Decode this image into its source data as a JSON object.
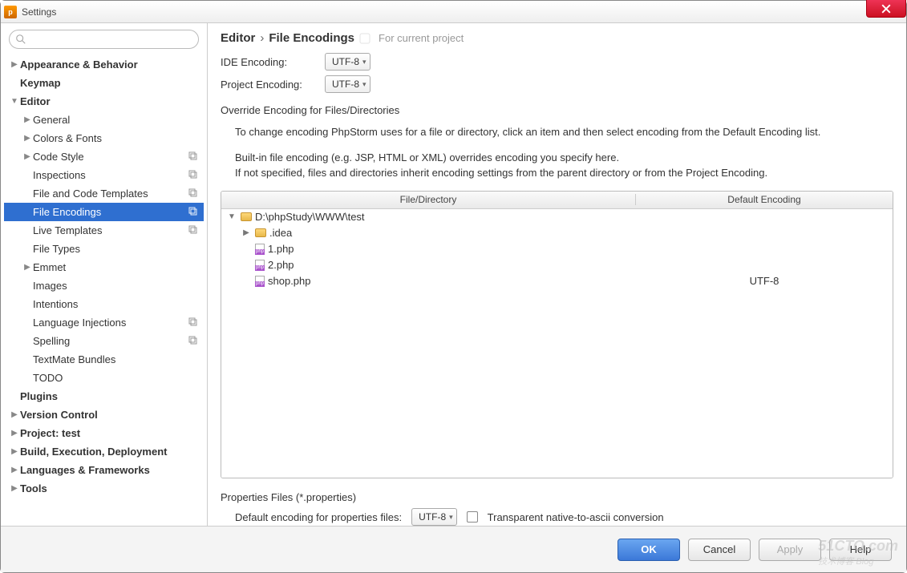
{
  "window": {
    "title": "Settings"
  },
  "sidebar": {
    "items": [
      {
        "label": "Appearance & Behavior",
        "bold": true,
        "arrow": "▶",
        "indent": 0
      },
      {
        "label": "Keymap",
        "bold": true,
        "arrow": "",
        "indent": 0
      },
      {
        "label": "Editor",
        "bold": true,
        "arrow": "▼",
        "indent": 0
      },
      {
        "label": "General",
        "arrow": "▶",
        "indent": 1
      },
      {
        "label": "Colors & Fonts",
        "arrow": "▶",
        "indent": 1
      },
      {
        "label": "Code Style",
        "arrow": "▶",
        "indent": 1,
        "copy": true
      },
      {
        "label": "Inspections",
        "arrow": "",
        "indent": 1,
        "copy": true
      },
      {
        "label": "File and Code Templates",
        "arrow": "",
        "indent": 1,
        "copy": true
      },
      {
        "label": "File Encodings",
        "arrow": "",
        "indent": 1,
        "copy": true,
        "selected": true
      },
      {
        "label": "Live Templates",
        "arrow": "",
        "indent": 1,
        "copy": true
      },
      {
        "label": "File Types",
        "arrow": "",
        "indent": 1
      },
      {
        "label": "Emmet",
        "arrow": "▶",
        "indent": 1
      },
      {
        "label": "Images",
        "arrow": "",
        "indent": 1
      },
      {
        "label": "Intentions",
        "arrow": "",
        "indent": 1
      },
      {
        "label": "Language Injections",
        "arrow": "",
        "indent": 1,
        "copy": true
      },
      {
        "label": "Spelling",
        "arrow": "",
        "indent": 1,
        "copy": true
      },
      {
        "label": "TextMate Bundles",
        "arrow": "",
        "indent": 1
      },
      {
        "label": "TODO",
        "arrow": "",
        "indent": 1
      },
      {
        "label": "Plugins",
        "bold": true,
        "arrow": "",
        "indent": 0
      },
      {
        "label": "Version Control",
        "bold": true,
        "arrow": "▶",
        "indent": 0
      },
      {
        "label": "Project: test",
        "bold": true,
        "arrow": "▶",
        "indent": 0
      },
      {
        "label": "Build, Execution, Deployment",
        "bold": true,
        "arrow": "▶",
        "indent": 0
      },
      {
        "label": "Languages & Frameworks",
        "bold": true,
        "arrow": "▶",
        "indent": 0
      },
      {
        "label": "Tools",
        "bold": true,
        "arrow": "▶",
        "indent": 0
      }
    ]
  },
  "breadcrumb": {
    "part1": "Editor",
    "part2": "File Encodings",
    "hint": "For current project"
  },
  "form": {
    "ide_label": "IDE Encoding:",
    "ide_value": "UTF-8",
    "proj_label": "Project Encoding:",
    "proj_value": "UTF-8",
    "override_label": "Override Encoding for Files/Directories",
    "help1": "To change encoding PhpStorm uses for a file or directory, click an item and then select encoding from the Default Encoding list.",
    "help2": "Built-in file encoding (e.g. JSP, HTML or XML) overrides encoding you specify here.",
    "help3": "If not specified, files and directories inherit encoding settings from the parent directory or from the Project Encoding."
  },
  "table": {
    "col1": "File/Directory",
    "col2": "Default Encoding",
    "rows": [
      {
        "arrow": "▼",
        "icon": "folder",
        "name": "D:\\phpStudy\\WWW\\test",
        "enc": "",
        "indent": 0
      },
      {
        "arrow": "▶",
        "icon": "folder",
        "name": ".idea",
        "enc": "",
        "indent": 1
      },
      {
        "arrow": "",
        "icon": "php",
        "name": "1.php",
        "enc": "",
        "indent": 1
      },
      {
        "arrow": "",
        "icon": "php",
        "name": "2.php",
        "enc": "",
        "indent": 1
      },
      {
        "arrow": "",
        "icon": "php",
        "name": "shop.php",
        "enc": "UTF-8",
        "indent": 1
      }
    ]
  },
  "props": {
    "section": "Properties Files (*.properties)",
    "label": "Default encoding for properties files:",
    "value": "UTF-8",
    "checkbox_label": "Transparent native-to-ascii conversion"
  },
  "buttons": {
    "ok": "OK",
    "cancel": "Cancel",
    "apply": "Apply",
    "help": "Help"
  },
  "watermark": {
    "line1": "51CTO.com",
    "line2": "技术博客  Blog"
  }
}
